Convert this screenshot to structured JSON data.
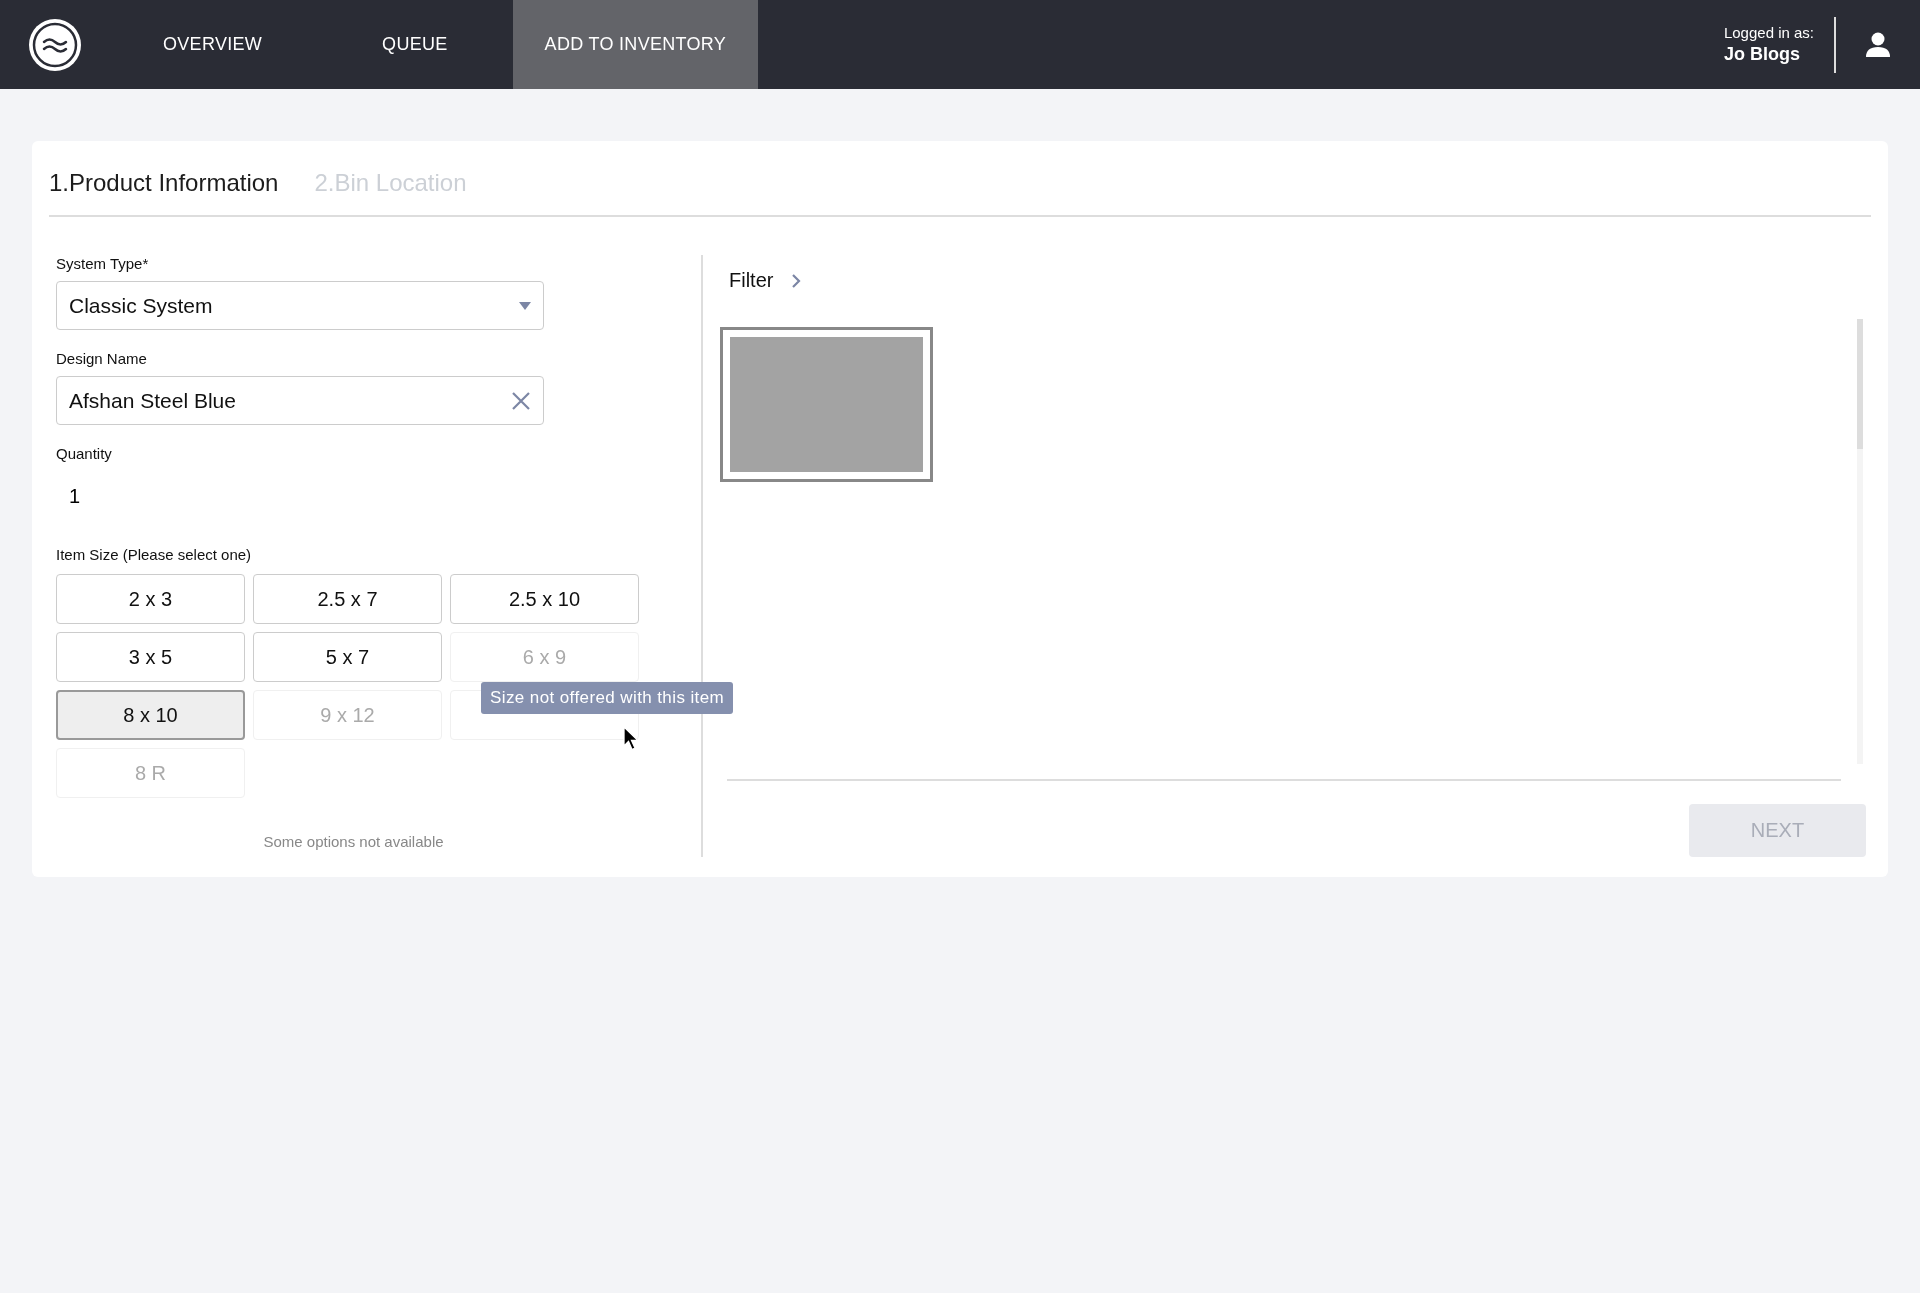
{
  "nav": {
    "items": [
      {
        "label": "OVERVIEW",
        "selected": false
      },
      {
        "label": "QUEUE",
        "selected": false
      },
      {
        "label": "ADD TO INVENTORY",
        "selected": true
      }
    ]
  },
  "user": {
    "caption": "Logged in as:",
    "name": "Jo Blogs"
  },
  "steps": [
    {
      "label": "1.Product Information",
      "selected": true
    },
    {
      "label": "2.Bin Location",
      "selected": false
    }
  ],
  "form": {
    "system_type": {
      "label": "System Type*",
      "value": "Classic System"
    },
    "design_name": {
      "label": "Design Name",
      "value": "Afshan Steel Blue"
    },
    "quantity": {
      "label": "Quantity",
      "value": "1"
    },
    "item_size": {
      "label": "Item Size (Please select one)",
      "options": [
        {
          "label": "2 x 3",
          "selected": false,
          "disabled": false
        },
        {
          "label": "2.5 x 7",
          "selected": false,
          "disabled": false
        },
        {
          "label": "2.5 x 10",
          "selected": false,
          "disabled": false
        },
        {
          "label": "3 x 5",
          "selected": false,
          "disabled": false
        },
        {
          "label": "5 x 7",
          "selected": false,
          "disabled": false
        },
        {
          "label": "6 x 9",
          "selected": false,
          "disabled": true
        },
        {
          "label": "8 x 10",
          "selected": true,
          "disabled": false
        },
        {
          "label": "9 x 12",
          "selected": false,
          "disabled": true
        },
        {
          "selected": false,
          "disabled": true
        },
        {
          "label": "8 R",
          "selected": false,
          "disabled": true
        }
      ],
      "note": "Some options not available"
    },
    "tooltip": "Size not offered with this item"
  },
  "results": {
    "filter": "Filter",
    "thumbnails": [
      {
        "selected": true
      }
    ]
  },
  "next": {
    "label": "NEXT",
    "disabled": true
  }
}
